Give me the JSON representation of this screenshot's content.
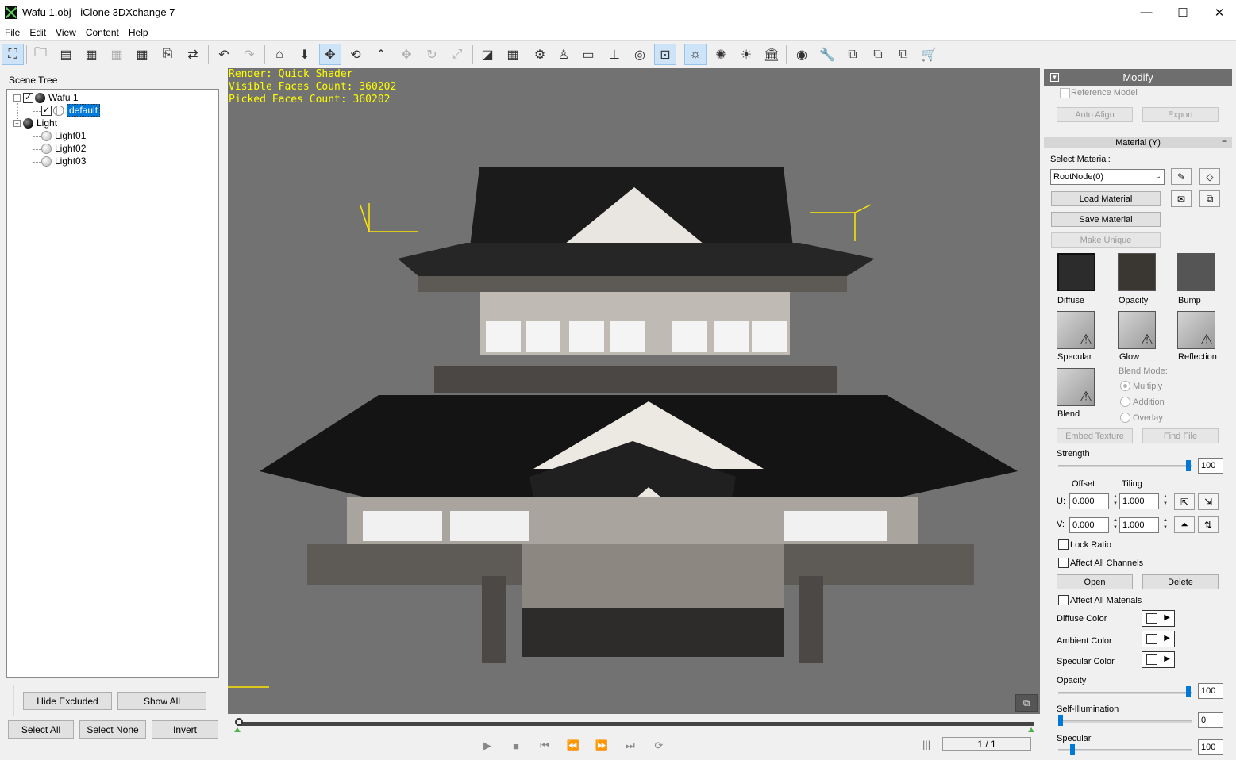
{
  "window": {
    "title": "Wafu  1.obj - iClone 3DXchange 7",
    "minimize": "—",
    "maximize": "☐",
    "close": "✕"
  },
  "menu": [
    "File",
    "Edit",
    "View",
    "Content",
    "Help"
  ],
  "toolbar": {
    "icons": [
      "scene-tree",
      "open",
      "import-ic",
      "import-fbx",
      "import-bvh",
      "import-obj",
      "export",
      "convert",
      "undo",
      "redo",
      "home",
      "drop-down",
      "move",
      "rotate-node",
      "pick",
      "move-axis",
      "rotate",
      "scale",
      "wireframe",
      "grid",
      "bone",
      "dummy",
      "plane",
      "ground",
      "globe",
      "fit",
      "light-a",
      "light-b",
      "light-c",
      "museum",
      "web",
      "tool",
      "sync-a",
      "sync-b",
      "sync-c",
      "store"
    ]
  },
  "scene_tree": {
    "label": "Scene Tree",
    "items": [
      {
        "label": "Wafu  1"
      },
      {
        "label": "default"
      },
      {
        "label": "Light"
      },
      {
        "label": "Light01"
      },
      {
        "label": "Light02"
      },
      {
        "label": "Light03"
      }
    ],
    "hide_excluded": "Hide Excluded",
    "show_all": "Show All",
    "select_all": "Select All",
    "select_none": "Select None",
    "invert": "Invert"
  },
  "viewport": {
    "hud": {
      "render": "Render: Quick Shader",
      "visible_faces": "Visible Faces Count: 360202",
      "picked_faces": "Picked Faces Count: 360202"
    }
  },
  "timeline": {
    "frame_counter": "1 / 1",
    "position": 0.0
  },
  "modify": {
    "title": "Modify",
    "reference_model": "Reference Model",
    "auto_align": "Auto Align",
    "export": "Export",
    "material_section": "Material  (Y)",
    "select_material_label": "Select Material:",
    "selected_material": "RootNode(0)",
    "load_material": "Load Material",
    "save_material": "Save Material",
    "make_unique": "Make Unique",
    "textures": {
      "diffuse": "Diffuse",
      "opacity": "Opacity",
      "bump": "Bump",
      "specular": "Specular",
      "glow": "Glow",
      "reflection": "Reflection",
      "blend": "Blend"
    },
    "blend_mode_label": "Blend Mode:",
    "blend_modes": {
      "multiply": "Multiply",
      "addition": "Addition",
      "overlay": "Overlay"
    },
    "embed_texture": "Embed Texture",
    "find_file": "Find File",
    "strength_label": "Strength",
    "strength": "100",
    "offset_label": "Offset",
    "tiling_label": "Tiling",
    "u_label": "U:",
    "v_label": "V:",
    "u_offset": "0.000",
    "u_tiling": "1.000",
    "v_offset": "0.000",
    "v_tiling": "1.000",
    "lock_ratio": "Lock Ratio",
    "affect_all_channels": "Affect All Channels",
    "open": "Open",
    "delete": "Delete",
    "affect_all_materials": "Affect All Materials",
    "diffuse_color": "Diffuse Color",
    "ambient_color": "Ambient Color",
    "specular_color": "Specular Color",
    "opacity_label": "Opacity",
    "opacity_value": "100",
    "self_illumination_label": "Self-Illumination",
    "self_illumination_value": "0",
    "specular_label": "Specular",
    "specular_value": "100",
    "colors": {
      "accent": "#0078d7",
      "hud": "#ffff00",
      "viewport_bg": "#727272"
    }
  }
}
